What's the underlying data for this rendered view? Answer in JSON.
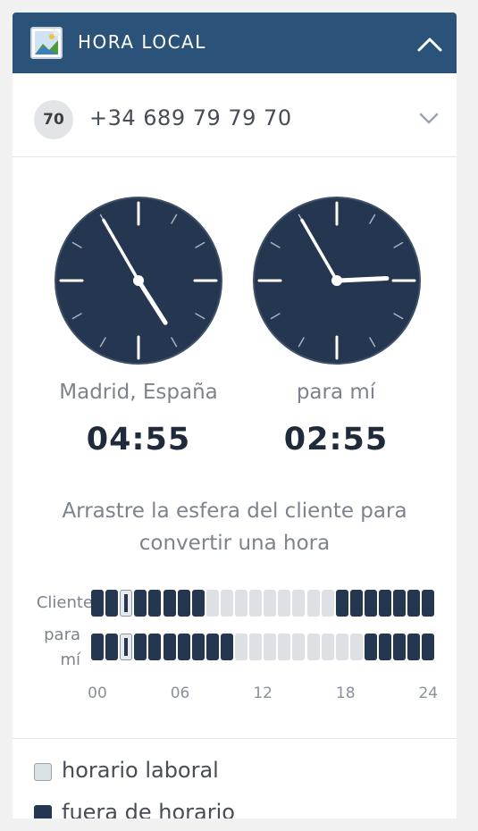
{
  "widget": {
    "title": "HORA LOCAL",
    "logo_icon": "image-icon",
    "collapse_icon": "chevron-up-icon",
    "header_color": "#2b5279"
  },
  "contact": {
    "badge": "70",
    "phone": "+34 689 79 79 70",
    "expand_icon": "chevron-down-icon"
  },
  "clocks": {
    "client": {
      "caption": "Madrid, España",
      "time": "04:55",
      "hour": 4,
      "minute": 55
    },
    "mine": {
      "caption": "para mí",
      "time": "02:55",
      "hour": 2,
      "minute": 55
    },
    "face_color": "#243650"
  },
  "hint": "Arrastre la esfera del cliente para convertir una hora",
  "timeline": {
    "client_label": "Cliente",
    "mine_label": "para mí",
    "ticks": [
      "00",
      "06",
      "12",
      "18",
      "24"
    ],
    "current_hour_index": 2,
    "client_off_hours": [
      0,
      1,
      2,
      3,
      4,
      5,
      6,
      7,
      17,
      18,
      19,
      20,
      21,
      22,
      23
    ],
    "mine_off_hours": [
      0,
      1,
      2,
      3,
      4,
      5,
      6,
      7,
      8,
      9,
      19,
      20,
      21,
      22,
      23
    ],
    "colors": {
      "off": "#243650",
      "work": "#dde1e6"
    }
  },
  "legend": {
    "work_label": "horario laboral",
    "off_label": "fuera de horario"
  }
}
